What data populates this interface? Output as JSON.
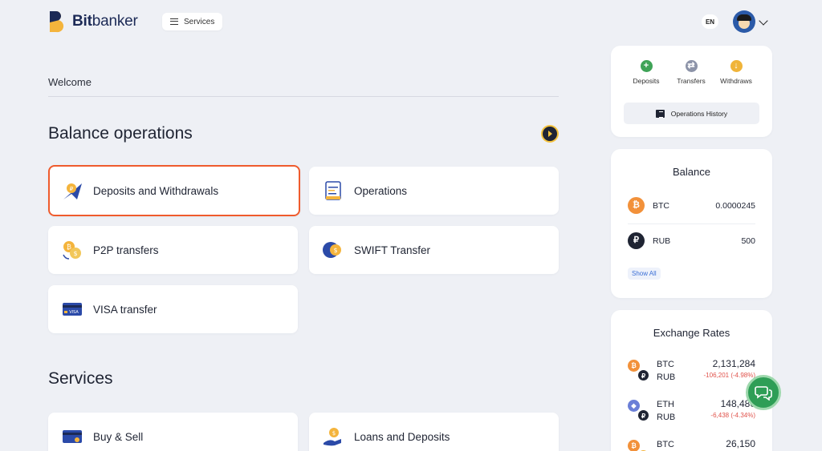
{
  "header": {
    "logo": {
      "bold": "Bit",
      "rest": "banker"
    },
    "services_label": "Services",
    "lang": "EN"
  },
  "welcome": "Welcome",
  "balance_ops": {
    "title": "Balance operations",
    "cards": [
      {
        "label": "Deposits and Withdrawals",
        "icon": "deposit-withdraw-icon",
        "active": true
      },
      {
        "label": "Operations",
        "icon": "document-icon"
      },
      {
        "label": "P2P transfers",
        "icon": "coins-exchange-icon"
      },
      {
        "label": "SWIFT Transfer",
        "icon": "swift-icon"
      },
      {
        "label": "VISA transfer",
        "icon": "visa-card-icon"
      }
    ]
  },
  "services": {
    "title": "Services",
    "cards": [
      {
        "label": "Buy & Sell",
        "icon": "card-icon"
      },
      {
        "label": "Loans and Deposits",
        "icon": "hand-coin-icon"
      }
    ]
  },
  "quick_actions": {
    "items": [
      {
        "label": "Deposits",
        "icon": "plus-icon",
        "color": "#3fa357"
      },
      {
        "label": "Transfers",
        "icon": "transfer-icon",
        "color": "#8c93a8"
      },
      {
        "label": "Withdraws",
        "icon": "withdraw-icon",
        "color": "#f0b43a"
      }
    ],
    "history_label": "Operations History"
  },
  "balance": {
    "title": "Balance",
    "rows": [
      {
        "symbol": "BTC",
        "amount": "0.0000245",
        "glyph": "₿",
        "color": "#f2913a"
      },
      {
        "symbol": "RUB",
        "amount": "500",
        "glyph": "₽",
        "color": "#1f2433"
      }
    ],
    "show_all": "Show All"
  },
  "rates": {
    "title": "Exchange Rates",
    "rows": [
      {
        "base": "BTC",
        "quote": "RUB",
        "value": "2,131,284",
        "change": "-106,201 (-4.98%)"
      },
      {
        "base": "ETH",
        "quote": "RUB",
        "value": "148,480",
        "change": "-6,438 (-4.34%)"
      },
      {
        "base": "BTC",
        "quote": "",
        "value": "26,150",
        "change": ""
      }
    ]
  },
  "colors": {
    "accent": "#ef5b2d",
    "brand": "#1c2a56",
    "chat": "#2e9e56"
  }
}
